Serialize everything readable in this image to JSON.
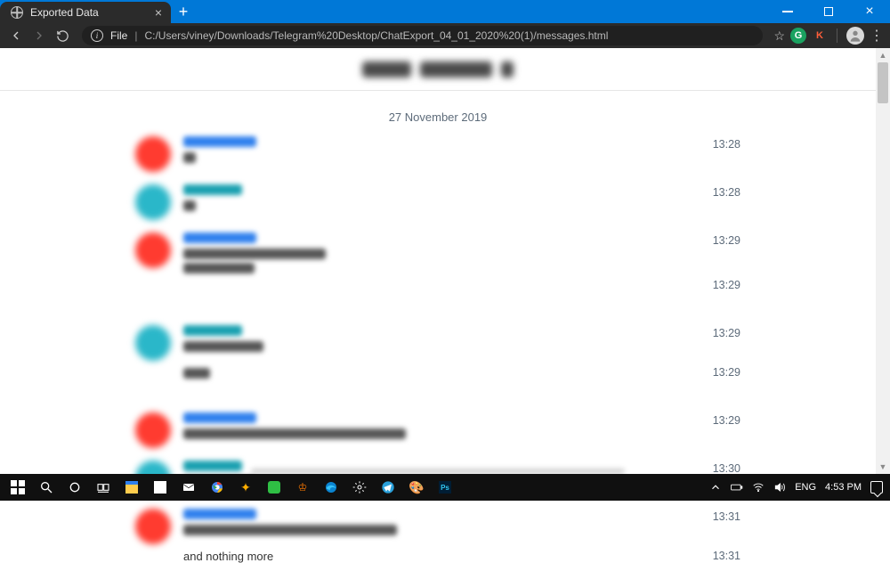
{
  "browser": {
    "tab_title": "Exported Data",
    "addr_scheme": "File",
    "addr_path": "C:/Users/viney/Downloads/Telegram%20Desktop/ChatExport_04_01_2020%20(1)/messages.html",
    "profile_letter": "K"
  },
  "chat": {
    "date": "27 November 2019",
    "messages": [
      {
        "avatar": "red",
        "name": "blue",
        "lines": [
          14
        ],
        "time": "13:28"
      },
      {
        "avatar": "teal",
        "name": "teal",
        "lines": [
          14
        ],
        "time": "13:28"
      },
      {
        "avatar": "red",
        "name": "blue",
        "lines": [
          160,
          80
        ],
        "time": "13:29"
      },
      {
        "avatar": "none",
        "name": "",
        "lines": [],
        "time": "13:29"
      },
      {
        "avatar": "teal",
        "name": "teal",
        "lines": [
          90
        ],
        "time": "13:29"
      },
      {
        "avatar": "none",
        "name": "",
        "lines": [
          30
        ],
        "time": "13:29"
      },
      {
        "avatar": "red",
        "name": "blue",
        "lines": [
          250
        ],
        "time": "13:29"
      },
      {
        "avatar": "teal",
        "name": "teal",
        "lines": [
          80
        ],
        "time": "13:30"
      },
      {
        "avatar": "red",
        "name": "blue",
        "lines": [
          240
        ],
        "time": "13:31"
      }
    ],
    "trailing_text": "and nothing more",
    "trailing_time": "13:31"
  },
  "tray": {
    "lang": "ENG",
    "time": "4:53 PM"
  }
}
